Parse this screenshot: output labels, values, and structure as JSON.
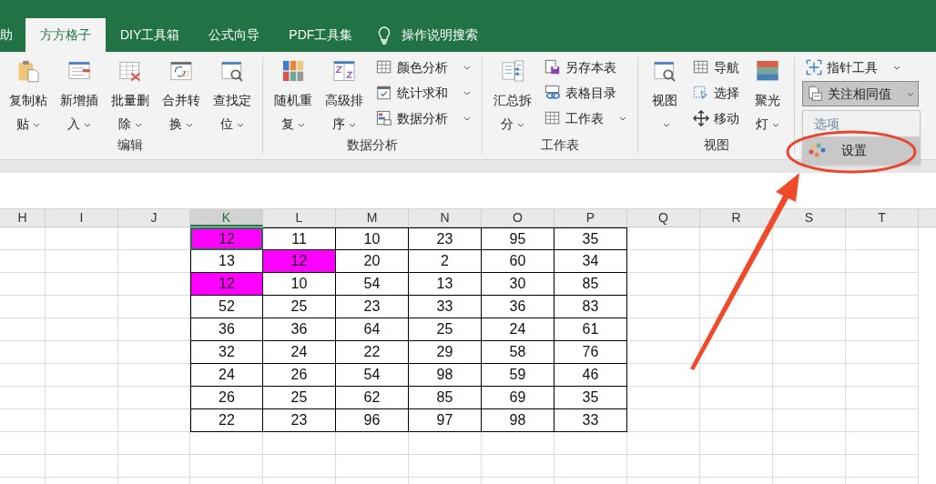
{
  "ribbon_tabs": [
    {
      "label": "助",
      "selected": false
    },
    {
      "label": "方方格子",
      "selected": true
    },
    {
      "label": "DIY工具箱",
      "selected": false
    },
    {
      "label": "公式向导",
      "selected": false
    },
    {
      "label": "PDF工具集",
      "selected": false
    }
  ],
  "tell_me": "操作说明搜索",
  "groups": [
    {
      "label": "编辑",
      "items": [
        {
          "kind": "big",
          "label": "复制粘贴",
          "dropdown": true
        },
        {
          "kind": "big",
          "label": "新增插入",
          "dropdown": true
        },
        {
          "kind": "big",
          "label": "批量删除",
          "dropdown": true
        },
        {
          "kind": "big",
          "label": "合并转换",
          "dropdown": true
        },
        {
          "kind": "big",
          "label": "查找定位",
          "dropdown": true
        }
      ]
    },
    {
      "label": "数据分析",
      "items": [
        {
          "kind": "big",
          "label": "随机重复",
          "dropdown": true
        },
        {
          "kind": "big",
          "label": "高级排序",
          "dropdown": true
        },
        {
          "kind": "stack",
          "buttons": [
            {
              "label": "颜色分析",
              "dropdown": true
            },
            {
              "label": "统计求和",
              "dropdown": true
            },
            {
              "label": "数据分析",
              "dropdown": true
            }
          ]
        }
      ]
    },
    {
      "label": "工作表",
      "items": [
        {
          "kind": "big",
          "label": "汇总拆分",
          "dropdown": true
        },
        {
          "kind": "stack",
          "buttons": [
            {
              "label": "另存本表",
              "dropdown": false
            },
            {
              "label": "表格目录",
              "dropdown": false
            },
            {
              "label": "工作表",
              "dropdown": true
            }
          ]
        }
      ]
    },
    {
      "label": "视图",
      "items": [
        {
          "kind": "big",
          "label": "视图",
          "dropdown": true
        },
        {
          "kind": "stack",
          "buttons": [
            {
              "label": "导航",
              "dropdown": false
            },
            {
              "label": "选择",
              "dropdown": false
            },
            {
              "label": "移动",
              "dropdown": false
            }
          ]
        },
        {
          "kind": "big",
          "label": "聚光灯",
          "dropdown": true
        }
      ]
    }
  ],
  "tools": [
    {
      "label": "指针工具",
      "dropdown": true,
      "pressed": false
    },
    {
      "label": "关注相同值",
      "dropdown": true,
      "pressed": true
    }
  ],
  "menu": {
    "header": "选项",
    "items": [
      {
        "label": "设置",
        "selected": true
      }
    ]
  },
  "columns": [
    {
      "label": "H",
      "selected": false
    },
    {
      "label": "I",
      "selected": false
    },
    {
      "label": "J",
      "selected": false
    },
    {
      "label": "K",
      "selected": true
    },
    {
      "label": "L",
      "selected": false
    },
    {
      "label": "M",
      "selected": false
    },
    {
      "label": "N",
      "selected": false
    },
    {
      "label": "O",
      "selected": false
    },
    {
      "label": "P",
      "selected": false
    },
    {
      "label": "Q",
      "selected": false
    },
    {
      "label": "R",
      "selected": false
    },
    {
      "label": "S",
      "selected": false
    },
    {
      "label": "T",
      "selected": false
    }
  ],
  "rows": [
    [
      {
        "v": "12",
        "fill": true,
        "selected": true
      },
      {
        "v": "11",
        "fill": false,
        "selected": false
      },
      {
        "v": "10",
        "fill": false,
        "selected": false
      },
      {
        "v": "23",
        "fill": false,
        "selected": false
      },
      {
        "v": "95",
        "fill": false,
        "selected": false
      },
      {
        "v": "35",
        "fill": false,
        "selected": false
      }
    ],
    [
      {
        "v": "13",
        "fill": false,
        "selected": false
      },
      {
        "v": "12",
        "fill": true,
        "selected": false
      },
      {
        "v": "20",
        "fill": false,
        "selected": false
      },
      {
        "v": "2",
        "fill": false,
        "selected": false
      },
      {
        "v": "60",
        "fill": false,
        "selected": false
      },
      {
        "v": "34",
        "fill": false,
        "selected": false
      }
    ],
    [
      {
        "v": "12",
        "fill": true,
        "selected": false
      },
      {
        "v": "10",
        "fill": false,
        "selected": false
      },
      {
        "v": "54",
        "fill": false,
        "selected": false
      },
      {
        "v": "13",
        "fill": false,
        "selected": false
      },
      {
        "v": "30",
        "fill": false,
        "selected": false
      },
      {
        "v": "85",
        "fill": false,
        "selected": false
      }
    ],
    [
      {
        "v": "52",
        "fill": false,
        "selected": false
      },
      {
        "v": "25",
        "fill": false,
        "selected": false
      },
      {
        "v": "23",
        "fill": false,
        "selected": false
      },
      {
        "v": "33",
        "fill": false,
        "selected": false
      },
      {
        "v": "36",
        "fill": false,
        "selected": false
      },
      {
        "v": "83",
        "fill": false,
        "selected": false
      }
    ],
    [
      {
        "v": "36",
        "fill": false,
        "selected": false
      },
      {
        "v": "36",
        "fill": false,
        "selected": false
      },
      {
        "v": "64",
        "fill": false,
        "selected": false
      },
      {
        "v": "25",
        "fill": false,
        "selected": false
      },
      {
        "v": "24",
        "fill": false,
        "selected": false
      },
      {
        "v": "61",
        "fill": false,
        "selected": false
      }
    ],
    [
      {
        "v": "32",
        "fill": false,
        "selected": false
      },
      {
        "v": "24",
        "fill": false,
        "selected": false
      },
      {
        "v": "22",
        "fill": false,
        "selected": false
      },
      {
        "v": "29",
        "fill": false,
        "selected": false
      },
      {
        "v": "58",
        "fill": false,
        "selected": false
      },
      {
        "v": "76",
        "fill": false,
        "selected": false
      }
    ],
    [
      {
        "v": "24",
        "fill": false,
        "selected": false
      },
      {
        "v": "26",
        "fill": false,
        "selected": false
      },
      {
        "v": "54",
        "fill": false,
        "selected": false
      },
      {
        "v": "98",
        "fill": false,
        "selected": false
      },
      {
        "v": "59",
        "fill": false,
        "selected": false
      },
      {
        "v": "46",
        "fill": false,
        "selected": false
      }
    ],
    [
      {
        "v": "26",
        "fill": false,
        "selected": false
      },
      {
        "v": "25",
        "fill": false,
        "selected": false
      },
      {
        "v": "62",
        "fill": false,
        "selected": false
      },
      {
        "v": "85",
        "fill": false,
        "selected": false
      },
      {
        "v": "69",
        "fill": false,
        "selected": false
      },
      {
        "v": "35",
        "fill": false,
        "selected": false
      }
    ],
    [
      {
        "v": "22",
        "fill": false,
        "selected": false
      },
      {
        "v": "23",
        "fill": false,
        "selected": false
      },
      {
        "v": "96",
        "fill": false,
        "selected": false
      },
      {
        "v": "97",
        "fill": false,
        "selected": false
      },
      {
        "v": "98",
        "fill": false,
        "selected": false
      },
      {
        "v": "33",
        "fill": false,
        "selected": false
      }
    ]
  ]
}
